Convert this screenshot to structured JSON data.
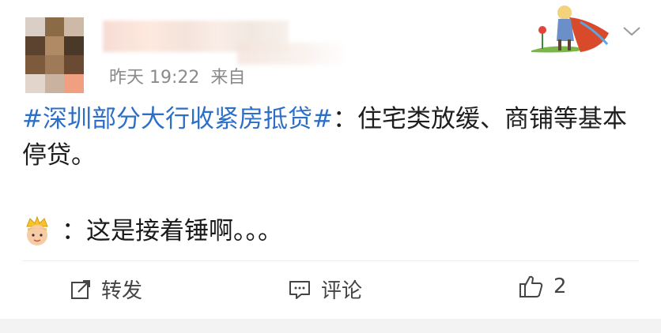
{
  "post": {
    "time": "昨天 19:22",
    "source": "来自",
    "topic": "#深圳部分大行收紧房抵贷#",
    "text": "：住宅类放缓、商铺等基本停贷。",
    "reply_text": "：这是接着锤啊。。。"
  },
  "actions": {
    "forward_label": "转发",
    "comment_label": "评论",
    "like_count": "2"
  },
  "colors": {
    "topic": "#2d6fc6",
    "meta": "#8a8a8a",
    "background": "#f3f3f3"
  },
  "icons": [
    "forward-icon",
    "comment-icon",
    "like-icon",
    "chevron-down-icon",
    "crown-emoji-icon",
    "decoration-badge-icon"
  ]
}
